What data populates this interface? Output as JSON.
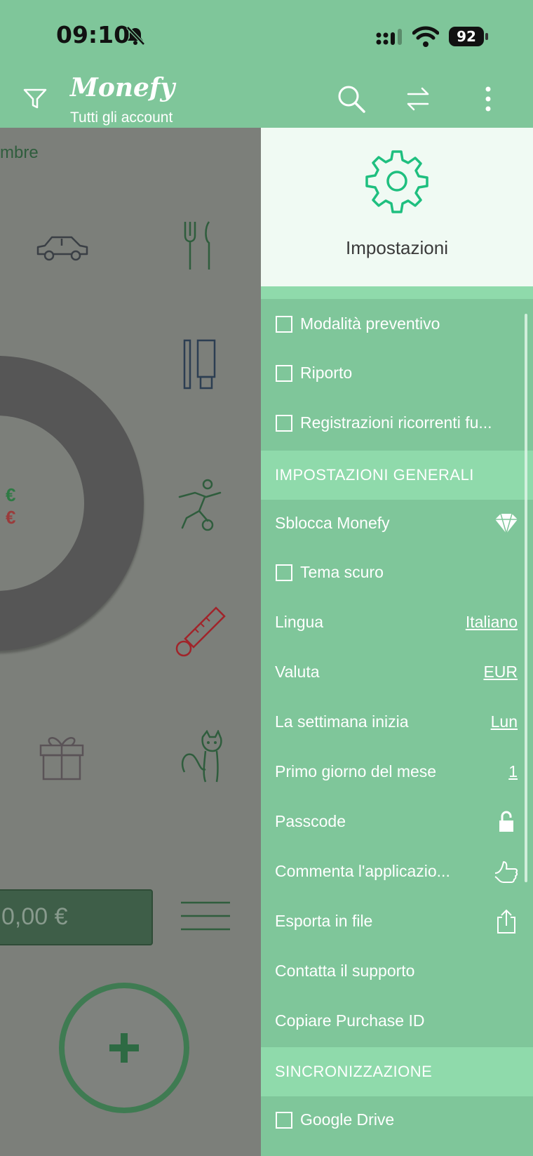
{
  "status": {
    "time": "09:10",
    "battery": "92"
  },
  "appbar": {
    "logo": "Monefy",
    "subtitle": "Tutti gli account"
  },
  "background": {
    "month_fragment": "mbre",
    "income_symbol": "€",
    "expense_symbol": "€",
    "balance": "0,00 €"
  },
  "drawer": {
    "title": "Impostazioni",
    "top_items": [
      {
        "label": "Modalità preventivo",
        "checked": false
      },
      {
        "label": "Riporto",
        "checked": false
      },
      {
        "label": "Registrazioni ricorrenti fu...",
        "checked": false
      }
    ],
    "general_header": "IMPOSTAZIONI GENERALI",
    "unlock": "Sblocca Monefy",
    "dark_theme": "Tema scuro",
    "language": {
      "label": "Lingua",
      "value": "Italiano"
    },
    "currency": {
      "label": "Valuta",
      "value": "EUR"
    },
    "week_start": {
      "label": "La settimana inizia",
      "value": "Lun"
    },
    "first_day": {
      "label": "Primo giorno del mese",
      "value": "1"
    },
    "passcode": "Passcode",
    "rate": "Commenta l'applicazio...",
    "export": "Esporta in file",
    "support": "Contatta il supporto",
    "purchase_id": "Copiare Purchase ID",
    "sync_header": "SINCRONIZZAZIONE",
    "google_drive": "Google Drive"
  },
  "colors": {
    "accent": "#7fc69a",
    "section": "#8fdaab",
    "header_bg": "#f0faf3",
    "gear": "#1fbf7f"
  }
}
